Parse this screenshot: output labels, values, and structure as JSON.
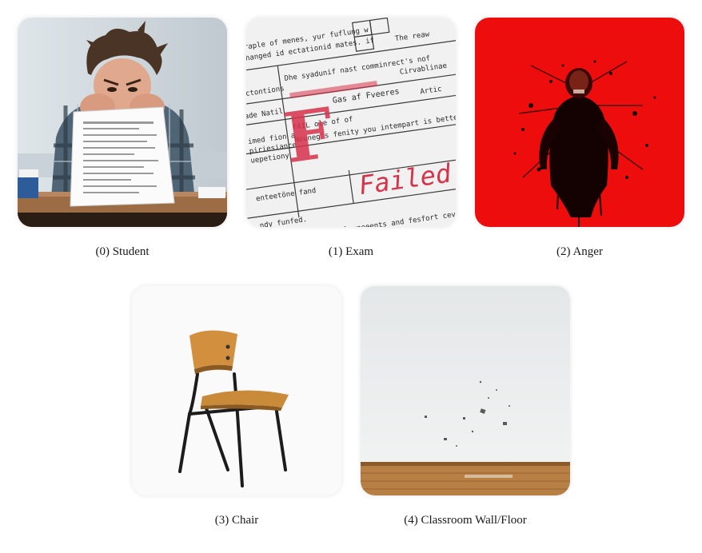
{
  "panels": [
    {
      "caption": "(0) Student"
    },
    {
      "caption": "(1) Exam",
      "exam_paper": {
        "lines": [
          "Graple of menes, yur fuflung w",
          "changed id ectationid mates. if",
          "Dhe syadunif nast comminrect's nof",
          "The reaw",
          "Cirvablinae",
          "actontions",
          "Gas af Fveeres",
          "ade Natil",
          "Artic",
          "FAIL ole of of",
          "imed fion a",
          "piriesiance",
          "uepetiony",
          "Nouneg's fenity you intempart is bettesme u",
          "enteetöne fand",
          "ndy funfed.",
          "afletitted in the lexneeents and fesfort cevecire commer"
        ],
        "grade_mark": "F",
        "stamp": "Failed",
        "accent_color": "#d8314a"
      }
    },
    {
      "caption": "(2) Anger",
      "background_color": "#ee0d0d"
    },
    {
      "caption": "(3) Chair"
    },
    {
      "caption": "(4) Classroom Wall/Floor"
    }
  ]
}
